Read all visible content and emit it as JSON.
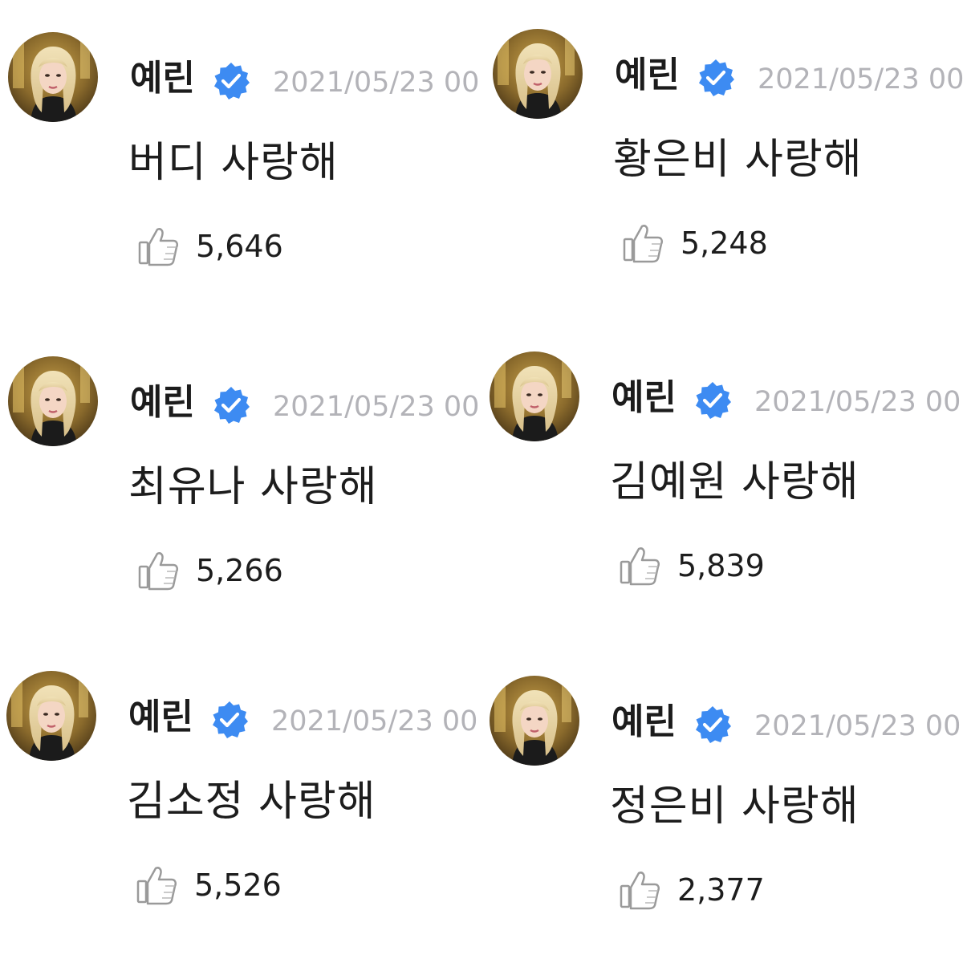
{
  "posts": [
    {
      "username": "예린",
      "timestamp": "2021/05/23 00",
      "message": "버디 사랑해",
      "likes": "5,646",
      "avatar_icon": "profile-photo",
      "verified_icon": "verified-badge-icon",
      "like_icon": "thumbs-up-icon"
    },
    {
      "username": "예린",
      "timestamp": "2021/05/23 00:",
      "message": "황은비 사랑해",
      "likes": "5,248",
      "avatar_icon": "profile-photo",
      "verified_icon": "verified-badge-icon",
      "like_icon": "thumbs-up-icon"
    },
    {
      "username": "예린",
      "timestamp": "2021/05/23 00",
      "message": "최유나 사랑해",
      "likes": "5,266",
      "avatar_icon": "profile-photo",
      "verified_icon": "verified-badge-icon",
      "like_icon": "thumbs-up-icon"
    },
    {
      "username": "예린",
      "timestamp": "2021/05/23 00",
      "message": "김예원 사랑해",
      "likes": "5,839",
      "avatar_icon": "profile-photo",
      "verified_icon": "verified-badge-icon",
      "like_icon": "thumbs-up-icon"
    },
    {
      "username": "예린",
      "timestamp": "2021/05/23 00",
      "message": "김소정 사랑해",
      "likes": "5,526",
      "avatar_icon": "profile-photo",
      "verified_icon": "verified-badge-icon",
      "like_icon": "thumbs-up-icon"
    },
    {
      "username": "예린",
      "timestamp": "2021/05/23 00",
      "message": "정은비 사랑해",
      "likes": "2,377",
      "avatar_icon": "profile-photo",
      "verified_icon": "verified-badge-icon",
      "like_icon": "thumbs-up-icon"
    }
  ],
  "colors": {
    "verified_blue": "#3d8bf2",
    "timestamp_gray": "#b3b3b8",
    "text": "#1d1d1d",
    "like_icon_gray": "#9a9a9a"
  }
}
